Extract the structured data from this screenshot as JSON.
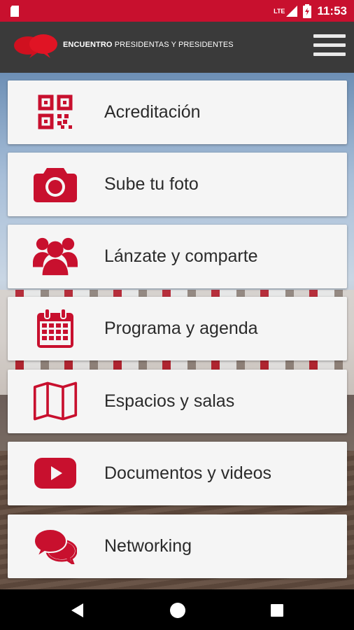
{
  "status_bar": {
    "time": "11:53",
    "network": "LTE",
    "colors": {
      "bar": "#c8102e"
    }
  },
  "app_bar": {
    "title_bold": "ENCUENTRO",
    "title_light": "PRESIDENTAS Y PRESIDENTES",
    "logo_icon": "speech-bubbles-logo",
    "menu_icon": "hamburger-menu-icon"
  },
  "menu": {
    "items": [
      {
        "label": "Acreditación",
        "icon": "qr-code-icon"
      },
      {
        "label": "Sube tu foto",
        "icon": "camera-icon"
      },
      {
        "label": "Lánzate y comparte",
        "icon": "group-icon"
      },
      {
        "label": "Programa y agenda",
        "icon": "calendar-icon"
      },
      {
        "label": "Espacios y salas",
        "icon": "map-icon"
      },
      {
        "label": "Documentos y videos",
        "icon": "youtube-play-icon"
      },
      {
        "label": "Networking",
        "icon": "chat-bubbles-icon"
      }
    ]
  },
  "nav_bar": {
    "back_icon": "back-triangle-icon",
    "home_icon": "home-circle-icon",
    "recents_icon": "recents-square-icon"
  },
  "theme": {
    "accent": "#c8102e",
    "card_bg": "#f5f5f5",
    "text": "#2b2b2b"
  }
}
